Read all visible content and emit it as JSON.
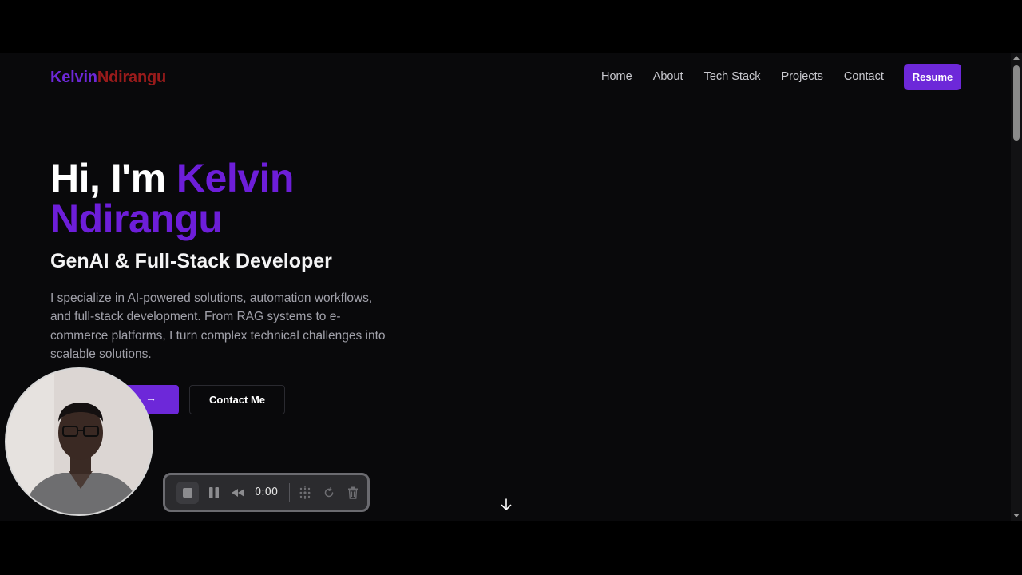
{
  "header": {
    "logo_first": "Kelvin",
    "logo_last": "Ndirangu",
    "nav": [
      "Home",
      "About",
      "Tech Stack",
      "Projects",
      "Contact"
    ],
    "resume": "Resume"
  },
  "hero": {
    "greeting": "Hi, I'm ",
    "name_line1": "Kelvin",
    "name_line2": "Ndirangu",
    "subtitle": "GenAI & Full-Stack Developer",
    "description": "I specialize in AI-powered solutions, automation workflows, and full-stack development. From RAG systems to e-commerce platforms, I turn complex technical challenges into scalable solutions.",
    "secondary_cta": "Contact Me",
    "primary_cta_arrow": "→"
  },
  "recorder": {
    "time": "0:00"
  },
  "colors": {
    "accent": "#6d28d9",
    "logo_last": "#991b1b",
    "background": "#09090b"
  },
  "icons": [
    "arrow-right-icon",
    "arrow-down-icon",
    "stop-icon",
    "pause-icon",
    "rewind-icon",
    "grid-dots-icon",
    "restart-icon",
    "trash-icon"
  ]
}
